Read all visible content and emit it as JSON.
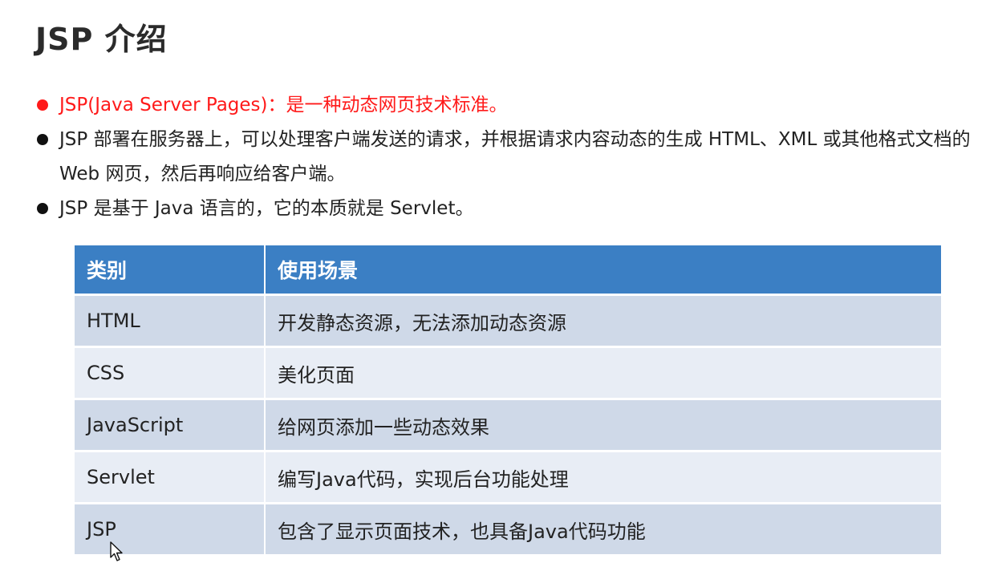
{
  "title": "JSP 介绍",
  "bullets": [
    {
      "text": "JSP(Java Server Pages)：是一种动态网页技术标准。",
      "color": "#ff1a1a"
    },
    {
      "text": "JSP 部署在服务器上，可以处理客户端发送的请求，并根据请求内容动态的生成 HTML、XML 或其他格式文档的 Web 网页，然后再响应给客户端。",
      "color": "#222222"
    },
    {
      "text": "JSP 是基于 Java 语言的，它的本质就是 Servlet。",
      "color": "#222222"
    }
  ],
  "table": {
    "headers": [
      "类别",
      "使用场景"
    ],
    "header_color": "#3b7fc4",
    "rows": [
      [
        "HTML",
        "开发静态资源，无法添加动态资源"
      ],
      [
        "CSS",
        "美化页面"
      ],
      [
        "JavaScript",
        "给网页添加一些动态效果"
      ],
      [
        "Servlet",
        "编写Java代码，实现后台功能处理"
      ],
      [
        "JSP",
        "包含了显示页面技术，也具备Java代码功能"
      ]
    ]
  },
  "icons": {
    "cursor": "mouse-pointer-icon"
  }
}
